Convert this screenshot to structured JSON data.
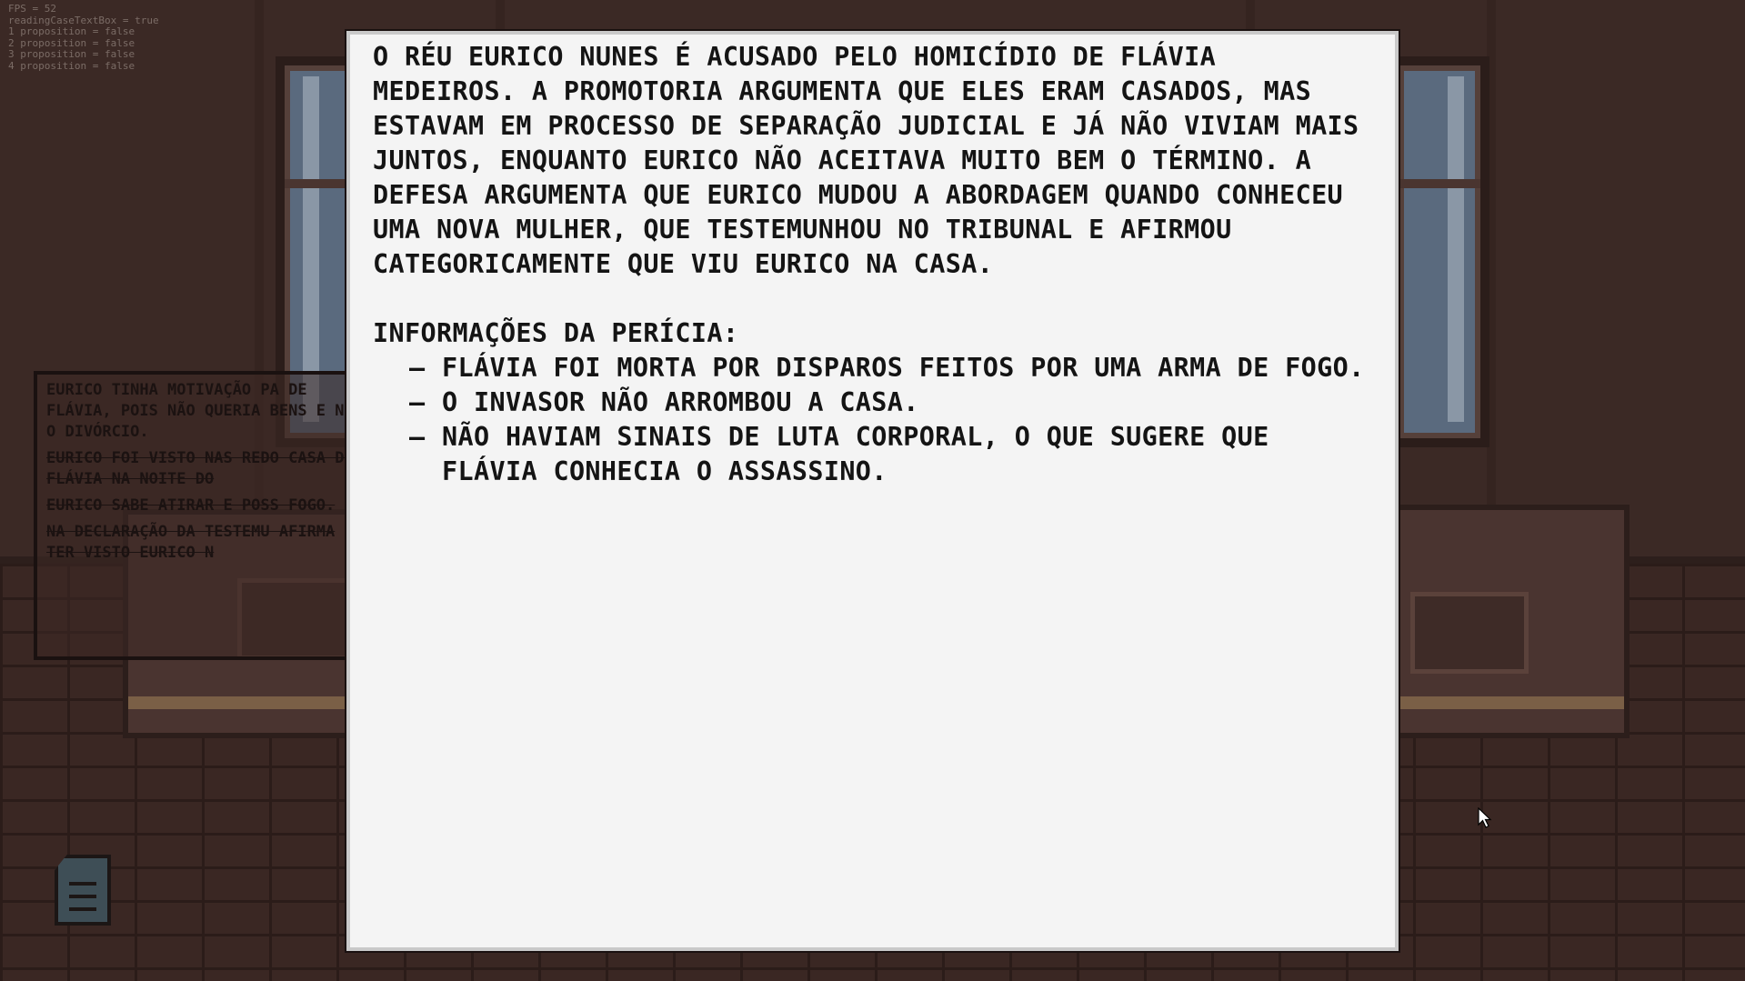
{
  "debug": {
    "lines": [
      "FPS = 52",
      "readingCaseTextBox = true",
      "1 proposition = false",
      "2 proposition = false",
      "3 proposition = false",
      "4 proposition = false"
    ]
  },
  "clues": [
    {
      "text": "EURICO TINHA MOTIVAÇÃO PARA O ASSASSINATO DE FLÁVIA, POIS NÃO QUERIA A DIVISÃO DE BENS E NEM O DIVÓRCIO.",
      "visible": "EURICO TINHA MOTIVAÇÃO PA DE FLÁVIA, POIS NÃO QUERIA BENS E NEM O DIVÓRCIO.",
      "crossed": false
    },
    {
      "text": "EURICO FOI VISTO NAS REDO CASA DE FLÁVIA NA NOITE DO",
      "crossed": true
    },
    {
      "text": "EURICO SABE ATIRAR E POSS FOGO.",
      "crossed": true
    },
    {
      "text": "NA DECLARAÇÃO DA TESTEMU AFIRMA TER VISTO EURICO N",
      "crossed": true
    }
  ],
  "case": {
    "intro": "O RÉU EURICO NUNES É ACUSADO PELO HOMICÍDIO DE FLÁVIA MEDEIROS. A PROMOTORIA ARGUMENTA QUE ELES ERAM CASADOS, MAS ESTAVAM EM PROCESSO DE SEPARAÇÃO JUDICIAL E JÁ NÃO VIVIAM MAIS JUNTOS, ENQUANTO EURICO NÃO ACEITAVA MUITO BEM O TÉRMINO. A DEFESA ARGUMENTA QUE EURICO MUDOU A ABORDAGEM QUANDO CONHECEU UMA NOVA MULHER, QUE TESTEMUNHOU NO TRIBUNAL E AFIRMOU CATEGORICAMENTE QUE VIU EURICO NA CASA.",
    "heading": "INFORMAÇÕES DA PERÍCIA:",
    "bullet": "–",
    "findings": [
      "FLÁVIA FOI MORTA POR DISPAROS FEITOS POR UMA ARMA DE FOGO.",
      "O INVASOR NÃO ARROMBOU A CASA.",
      "NÃO HAVIAM SINAIS DE LUTA CORPORAL, O QUE SUGERE QUE FLÁVIA CONHECIA O ASSASSINO."
    ]
  },
  "icons": {
    "document": "document-icon",
    "cursor": "mouse-cursor-icon"
  }
}
